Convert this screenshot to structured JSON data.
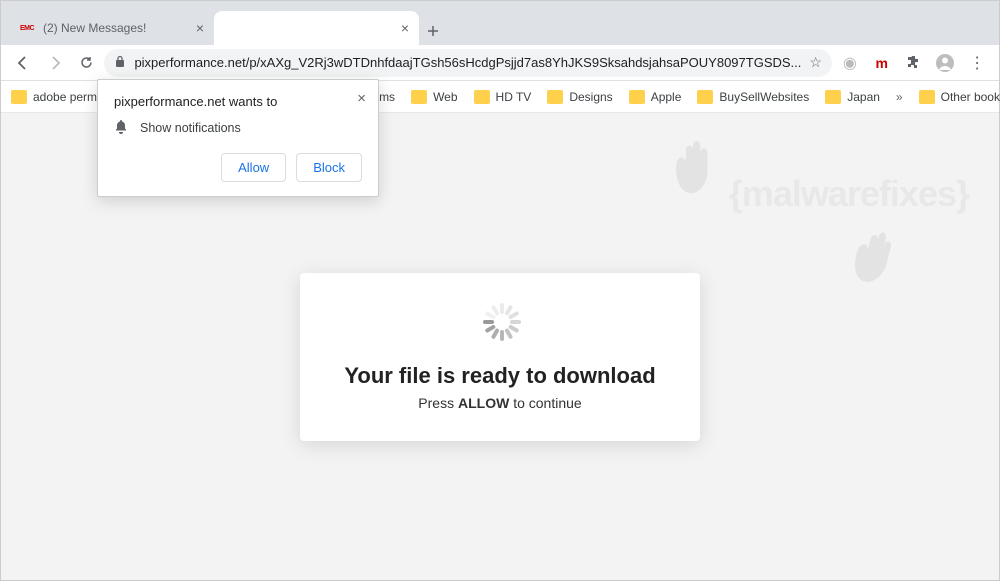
{
  "window": {
    "tabs": [
      {
        "favicon": "emc",
        "label": "(2) New Messages!"
      },
      {
        "favicon": "",
        "label": ""
      }
    ]
  },
  "addrbar": {
    "url": "pixperformance.net/p/xAXg_V2Rj3wDTDnhfdaajTGsh56sHcdgPsjjd7as8YhJKS9SksahdsjahsaPOUY8097TGSDS..."
  },
  "bookmarks": {
    "items": [
      "adobe permie",
      "Forums",
      "Web",
      "HD TV",
      "Designs",
      "Apple",
      "BuySellWebsites",
      "Japan"
    ],
    "other": "Other bookmarks"
  },
  "permission": {
    "header": "pixperformance.net wants to",
    "item": "Show notifications",
    "allow": "Allow",
    "block": "Block"
  },
  "watermark": "{malwarefixes}",
  "card": {
    "title": "Your file is ready to download",
    "sub_pre": "Press ",
    "sub_bold": "ALLOW",
    "sub_post": " to continue"
  }
}
